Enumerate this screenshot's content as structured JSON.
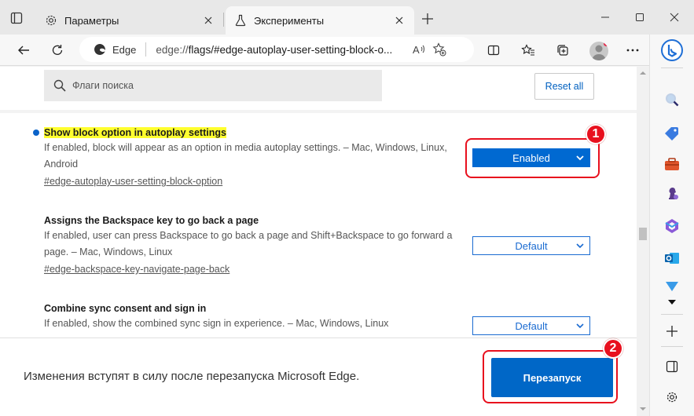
{
  "tabs": [
    {
      "label": "Параметры",
      "icon": "gear-icon"
    },
    {
      "label": "Эксперименты",
      "icon": "flask-icon"
    }
  ],
  "toolbar": {
    "site_label": "Edge",
    "url_prefix": "edge://",
    "url_main": "flags/#edge-autoplay-user-setting-block-o..."
  },
  "search": {
    "placeholder": "Флаги поиска"
  },
  "reset_label": "Reset all",
  "flags": [
    {
      "title": "Show block option in autoplay settings",
      "description": "If enabled, block will appear as an option in media autoplay settings. – Mac, Windows, Linux, Android",
      "link": "#edge-autoplay-user-setting-block-option",
      "value": "Enabled",
      "highlighted": true
    },
    {
      "title": "Assigns the Backspace key to go back a page",
      "description": "If enabled, user can press Backspace to go back a page and Shift+Backspace to go forward a page. – Mac, Windows, Linux",
      "link": "#edge-backspace-key-navigate-page-back",
      "value": "Default",
      "highlighted": false
    },
    {
      "title": "Combine sync consent and sign in",
      "description": "If enabled, show the combined sync sign in experience. – Mac, Windows, Linux",
      "value": "Default",
      "highlighted": false
    }
  ],
  "annotations": [
    "1",
    "2"
  ],
  "bottom": {
    "message": "Изменения вступят в силу после перезапуска Microsoft Edge.",
    "restart_label": "Перезапуск"
  },
  "colors": {
    "accent": "#0067c7",
    "highlight": "#ffff2e",
    "annotation": "#e8101e"
  }
}
